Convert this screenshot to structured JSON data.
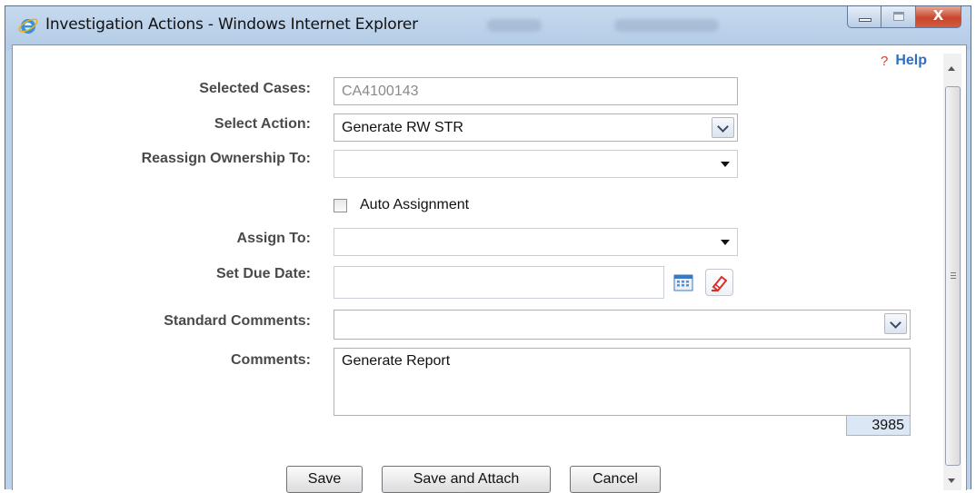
{
  "window": {
    "title": "Investigation Actions - Windows Internet Explorer",
    "close_glyph": "X"
  },
  "help": {
    "label": "Help",
    "icon": "?"
  },
  "form": {
    "selected_cases": {
      "label": "Selected Cases:",
      "value": "CA4100143"
    },
    "select_action": {
      "label": "Select Action:",
      "value": "Generate RW STR"
    },
    "reassign_ownership": {
      "label": "Reassign Ownership To:",
      "value": ""
    },
    "auto_assignment": {
      "label": "Auto Assignment",
      "checked": false
    },
    "assign_to": {
      "label": "Assign To:",
      "value": ""
    },
    "due_date": {
      "label": "Set Due Date:",
      "value": ""
    },
    "standard_comments": {
      "label": "Standard Comments:",
      "value": ""
    },
    "comments": {
      "label": "Comments:",
      "value": "Generate Report",
      "remaining_chars": "3985"
    }
  },
  "buttons": {
    "save": "Save",
    "save_attach": "Save and Attach",
    "cancel": "Cancel"
  },
  "colors": {
    "title_bar": "#bcd2ea",
    "help_link": "#2f6fc0",
    "counter_bg": "#dbe7f4"
  }
}
